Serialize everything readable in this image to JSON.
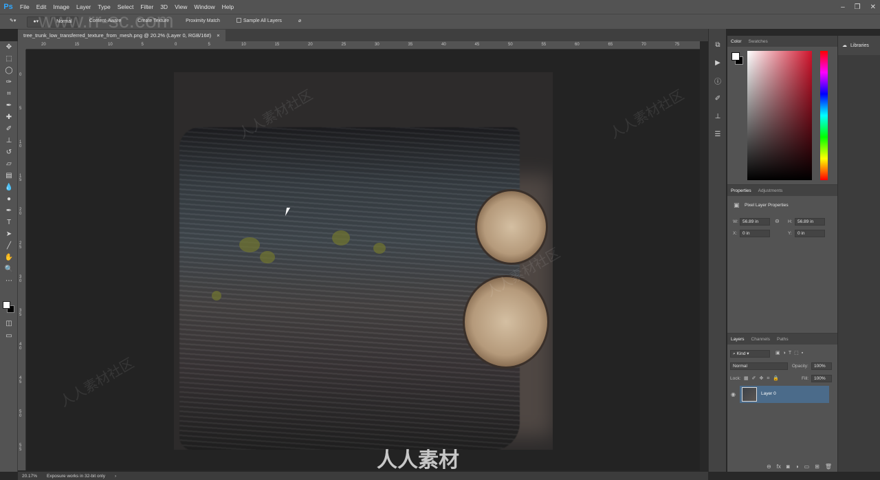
{
  "app": {
    "logo": "Ps"
  },
  "menu": [
    "File",
    "Edit",
    "Image",
    "Layer",
    "Type",
    "Select",
    "Filter",
    "3D",
    "View",
    "Window",
    "Help"
  ],
  "window_controls": {
    "minimize": "–",
    "restore": "❐",
    "close": "✕"
  },
  "options": {
    "mode_value": "Normal",
    "type_content_aware": "Content-Aware",
    "type_create_texture": "Create Texture",
    "type_proximity_match": "Proximity Match",
    "sample_all_layers": "Sample All Layers"
  },
  "document": {
    "tab_title": "tree_trunk_low_transferred_texture_from_mesh.png @ 20.2% (Layer 0, RGB/16#)",
    "close": "×"
  },
  "rulers": {
    "top_labels": [
      "20",
      "15",
      "10",
      "5",
      "0",
      "5",
      "10",
      "15",
      "20",
      "25",
      "30",
      "35",
      "40",
      "45",
      "50",
      "55",
      "60",
      "65",
      "70",
      "75"
    ],
    "left_labels": [
      "0",
      "5",
      "1 0",
      "1 5",
      "2 0",
      "2 5",
      "3 0",
      "3 5",
      "4 0",
      "4 5",
      "5 0",
      "5 5"
    ]
  },
  "color_panel": {
    "tabs": [
      "Color",
      "Swatches"
    ]
  },
  "properties_panel": {
    "tabs": [
      "Properties",
      "Adjustments"
    ],
    "title": "Pixel Layer Properties",
    "w_label": "W:",
    "w_value": "56.89 in",
    "h_label": "H:",
    "h_value": "56.89 in",
    "x_label": "X:",
    "x_value": "0 in",
    "y_label": "Y:",
    "y_value": "0 in"
  },
  "layers_panel": {
    "tabs": [
      "Layers",
      "Channels",
      "Paths"
    ],
    "filter_kind": "Kind",
    "blend_mode": "Normal",
    "opacity_label": "Opacity:",
    "opacity_value": "100%",
    "lock_label": "Lock:",
    "fill_label": "Fill:",
    "fill_value": "100%",
    "layers": [
      {
        "name": "Layer 0"
      }
    ]
  },
  "libraries": {
    "label": "Libraries"
  },
  "status": {
    "zoom": "20.17%",
    "message": "Exposure works in 32-bit only"
  },
  "watermarks": {
    "url": "www.rr-sc.com",
    "repeated": "人人素材社区",
    "bottom": "人人素材"
  },
  "colors": {
    "accent": "#31a8ff",
    "panel_bg": "#535353",
    "workspace_bg": "#232323",
    "layer_selected": "#4b6b8a"
  }
}
